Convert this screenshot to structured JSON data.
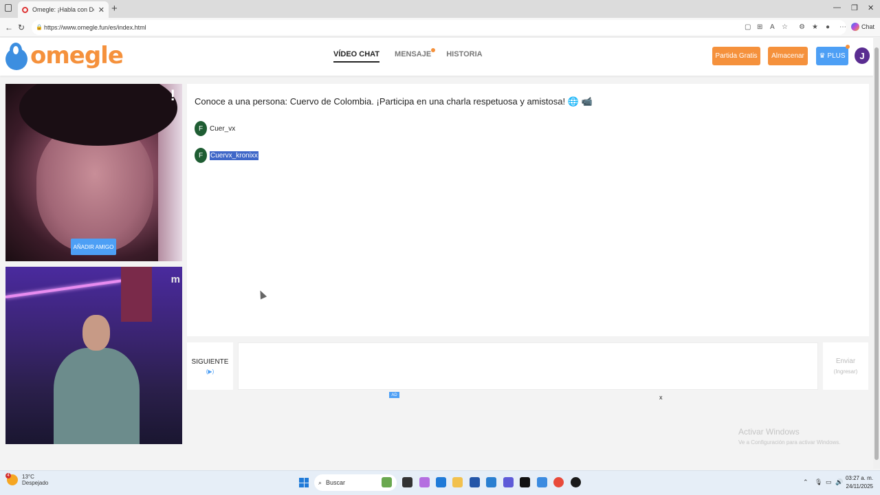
{
  "browser": {
    "tab_title": "Omegle: ¡Habla con Descon",
    "url": "https://www.omegle.fun/es/index.html",
    "copilot_label": "Chat"
  },
  "header": {
    "logo_text": "omegle",
    "nav": [
      {
        "label": "VÍDEO CHAT",
        "active": true
      },
      {
        "label": "MENSAJE",
        "active": false
      },
      {
        "label": "HISTORIA",
        "active": false
      }
    ],
    "btn_free": "Partida Gratis",
    "btn_store": "Almacenar",
    "btn_plus": "PLUS",
    "avatar_letter": "J"
  },
  "video": {
    "remote_flag": "!",
    "add_friend": "AÑADIR AMIGO",
    "local_mark": "m"
  },
  "chat": {
    "intro": "Conoce a una persona: Cuervo de Colombia. ¡Participa en una charla respetuosa y amistosa! 🌐 📹",
    "messages": [
      {
        "initial": "F",
        "text": "Cuer_vx"
      },
      {
        "initial": "F",
        "text": "Cuervx_kronixx"
      }
    ]
  },
  "controls": {
    "next_label": "SIGUIENTE",
    "next_hint": "(▶)",
    "message_placeholder": "",
    "send_label": "Enviar",
    "send_hint": "(Ingresar)",
    "ad_badge": "AD",
    "ad_close": "x"
  },
  "watermark": {
    "line1": "Activar Windows",
    "line2": "Ve a Configuración para activar Windows."
  },
  "taskbar": {
    "weather_temp": "13°C",
    "weather_desc": "Despejado",
    "weather_badge": "4",
    "search_label": "Buscar",
    "time": "03:27 a. m.",
    "date": "24/11/2025"
  },
  "colors": {
    "brand_orange": "#f5913c",
    "brand_blue": "#4d9ff5",
    "chat_pill": "#1f5d33",
    "selection": "#3f67c8"
  }
}
